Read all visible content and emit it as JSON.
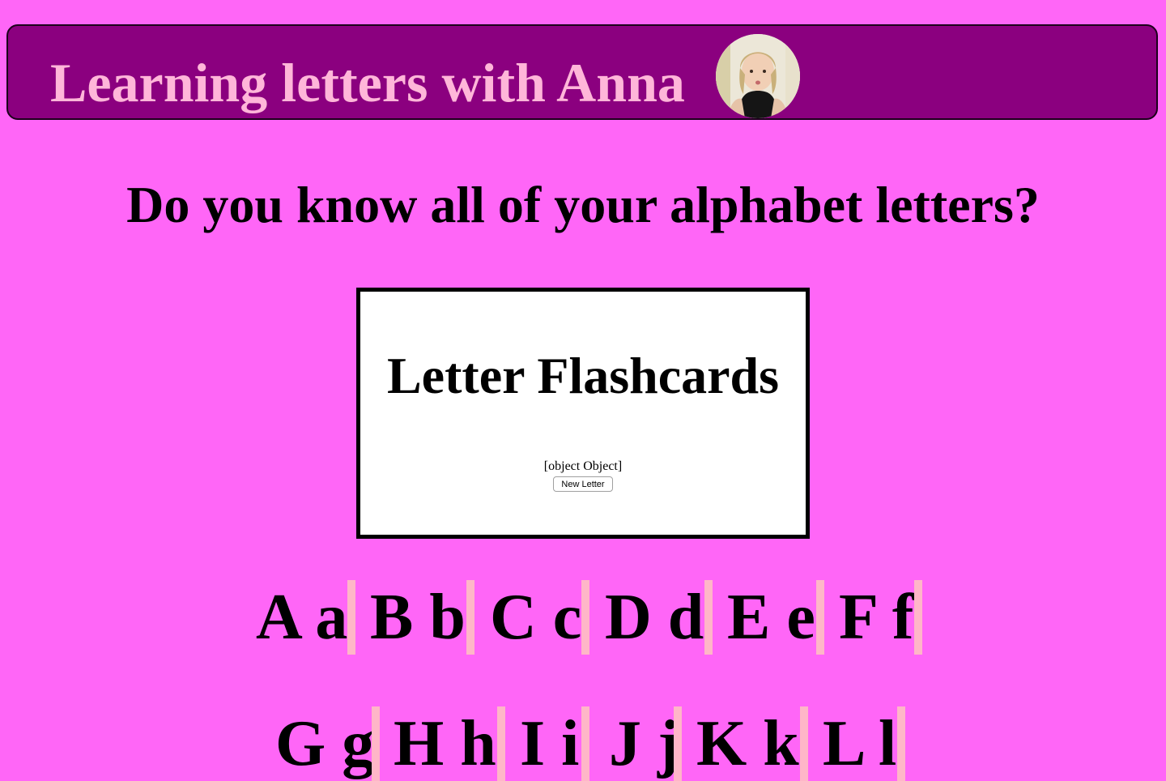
{
  "header": {
    "title": "Learning letters with Anna",
    "avatar_icon": "child-portrait-icon"
  },
  "question": "Do you know all of your alphabet letters?",
  "flashcard": {
    "title": "Letter Flashcards",
    "value": "[object Object]",
    "button_label": "New Letter"
  },
  "rows": [
    {
      "pairs": [
        {
          "label": "A a"
        },
        {
          "label": "B b"
        },
        {
          "label": "C c"
        },
        {
          "label": "D d"
        },
        {
          "label": "E e"
        },
        {
          "label": "F f"
        }
      ]
    },
    {
      "pairs": [
        {
          "label": "G g"
        },
        {
          "label": "H h"
        },
        {
          "label": "I i"
        },
        {
          "label": "J j"
        },
        {
          "label": "K k"
        },
        {
          "label": "L l"
        }
      ]
    }
  ],
  "colors": {
    "page_background": "#ff66f7",
    "header_background": "#8b007f",
    "header_text": "#ffb6d9",
    "divider": "#ffb6c8"
  }
}
